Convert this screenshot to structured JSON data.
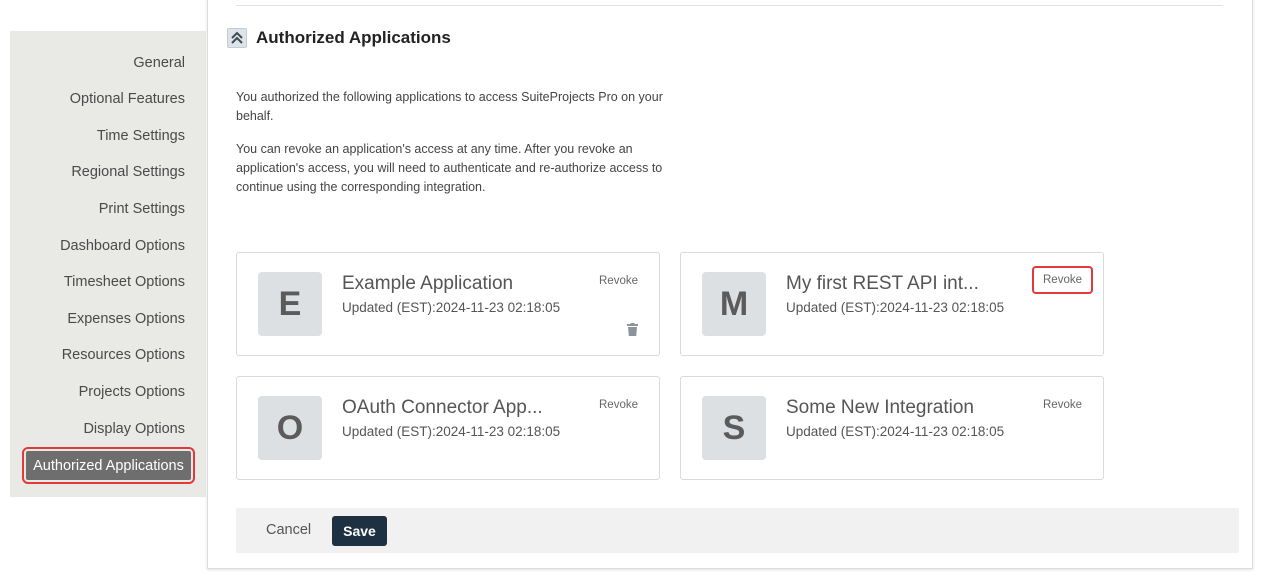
{
  "sidebar": {
    "items": [
      {
        "label": "General"
      },
      {
        "label": "Optional Features"
      },
      {
        "label": "Time Settings"
      },
      {
        "label": "Regional Settings"
      },
      {
        "label": "Print Settings"
      },
      {
        "label": "Dashboard Options"
      },
      {
        "label": "Timesheet Options"
      },
      {
        "label": "Expenses Options"
      },
      {
        "label": "Resources Options"
      },
      {
        "label": "Projects Options"
      },
      {
        "label": "Display Options"
      },
      {
        "label": "Authorized Applications"
      }
    ],
    "active_index": 11
  },
  "section": {
    "title": "Authorized Applications",
    "para1": "You authorized the following applications to access SuiteProjects Pro on your behalf.",
    "para2": "You can revoke an application's access at any time. After you revoke an application's access, you will need to authenticate and re-authorize access to continue using the corresponding integration."
  },
  "apps": [
    {
      "initial": "E",
      "name": "Example Application",
      "updated": "Updated (EST):2024-11-23 02:18:05",
      "revoke": "Revoke",
      "icon": "trash-icon"
    },
    {
      "initial": "M",
      "name": "My first REST API int...",
      "updated": "Updated (EST):2024-11-23 02:18:05",
      "revoke": "Revoke"
    },
    {
      "initial": "O",
      "name": "OAuth Connector App...",
      "updated": "Updated (EST):2024-11-23 02:18:05",
      "revoke": "Revoke"
    },
    {
      "initial": "S",
      "name": "Some New Integration",
      "updated": "Updated (EST):2024-11-23 02:18:05",
      "revoke": "Revoke"
    }
  ],
  "footer": {
    "cancel_label": "Cancel",
    "save_label": "Save"
  },
  "colors": {
    "highlight": "#e03a3a",
    "save_button": "#1e3142",
    "active_nav": "#6e6e6e",
    "sidebar_bg": "#e9e9e6"
  }
}
